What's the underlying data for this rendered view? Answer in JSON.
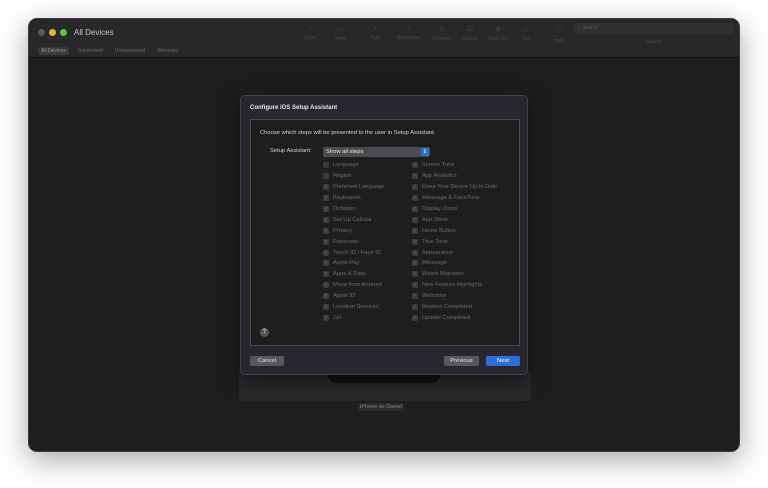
{
  "window": {
    "title": "All Devices",
    "tabs": [
      "All Devices",
      "Supervised",
      "Unsupervised",
      "Recovery"
    ],
    "toolbar": [
      "Back",
      "View",
      "Add",
      "Blueprints",
      "Prepare",
      "Update",
      "Back Up",
      "Tag",
      "Help"
    ],
    "search_placeholder": "Search",
    "search_label": "Search"
  },
  "device": {
    "name": "iPhone de Daniel"
  },
  "dialog": {
    "title": "Configure iOS Setup Assistant",
    "description": "Choose which steps will be presented to the user in Setup Assistant.",
    "setup_label": "Setup Assistant:",
    "setup_value": "Show all steps",
    "left_steps": [
      {
        "label": "Language",
        "checked": false
      },
      {
        "label": "Region",
        "checked": false
      },
      {
        "label": "Preferred Language",
        "checked": true
      },
      {
        "label": "Keyboards",
        "checked": true
      },
      {
        "label": "Dictation",
        "checked": true
      },
      {
        "label": "Set Up Cellular",
        "checked": true
      },
      {
        "label": "Privacy",
        "checked": true
      },
      {
        "label": "Passcode",
        "checked": true
      },
      {
        "label": "Touch ID / Face ID",
        "checked": true
      },
      {
        "label": "Apple Pay",
        "checked": true
      },
      {
        "label": "Apps & Data",
        "checked": true
      },
      {
        "label": "Move from Android",
        "checked": true
      },
      {
        "label": "Apple ID",
        "checked": true
      },
      {
        "label": "Location Services",
        "checked": true
      },
      {
        "label": "Siri",
        "checked": true
      }
    ],
    "right_steps": [
      {
        "label": "Screen Time",
        "checked": true
      },
      {
        "label": "App Analytics",
        "checked": true
      },
      {
        "label": "Keep Your Device Up to Date",
        "checked": true
      },
      {
        "label": "iMessage & FaceTime",
        "checked": true
      },
      {
        "label": "Display Zoom",
        "checked": true
      },
      {
        "label": "App Store",
        "checked": true
      },
      {
        "label": "Home Button",
        "checked": true
      },
      {
        "label": "True Tone",
        "checked": true
      },
      {
        "label": "Appearance",
        "checked": true
      },
      {
        "label": "iMessage",
        "checked": true
      },
      {
        "label": "Watch Migration",
        "checked": true
      },
      {
        "label": "New Feature Highlights",
        "checked": true
      },
      {
        "label": "Welcome",
        "checked": true
      },
      {
        "label": "Restore Completed",
        "checked": true
      },
      {
        "label": "Update Completed",
        "checked": true
      }
    ],
    "cancel": "Cancel",
    "previous": "Previous",
    "next": "Next"
  },
  "colors": {
    "accent": "#2f6ed9"
  }
}
